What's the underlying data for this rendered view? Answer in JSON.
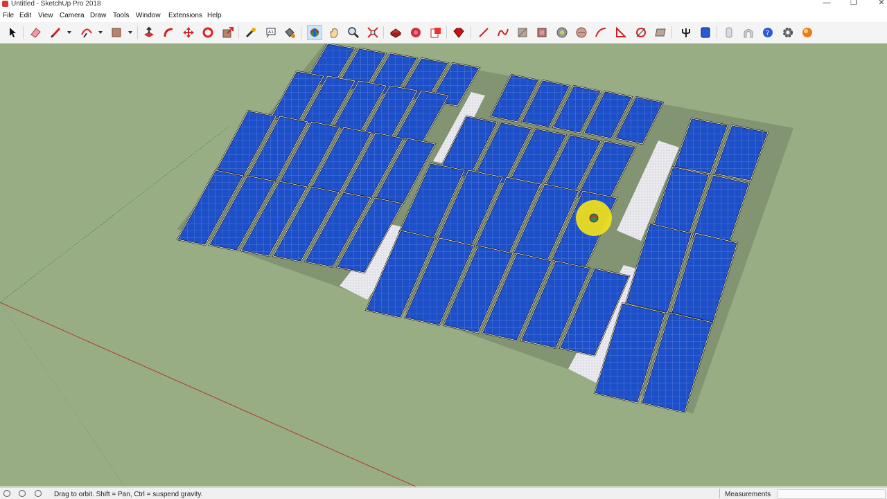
{
  "window": {
    "title": "Untitled - SketchUp Pro 2018",
    "minimize_glyph": "—",
    "restore_glyph": "❐",
    "close_glyph": "✕"
  },
  "menu": [
    "File",
    "Edit",
    "View",
    "Camera",
    "Draw",
    "Tools",
    "Window",
    "Extensions",
    "Help"
  ],
  "toolbar": {
    "active_tool": "orbit-icon",
    "tools": [
      "select-icon",
      "eraser-icon",
      "pencil-icon",
      "arc-icon",
      "rectangle-icon",
      "push-pull-icon",
      "follow-me-icon",
      "move-icon",
      "rotate-icon",
      "scale-icon",
      "tape-measure-icon",
      "text-icon",
      "paint-bucket-icon",
      "orbit-icon",
      "pan-icon",
      "zoom-icon",
      "zoom-extents-icon",
      "warehouse-icon",
      "extension-warehouse-icon",
      "layout-icon",
      "ruby-icon",
      "freehand-line-icon",
      "bezier-icon",
      "sandbox-grid-icon",
      "stamp-icon",
      "smoove-icon",
      "drape-icon",
      "add-detail-icon",
      "flip-edge-icon",
      "section-cut-icon",
      "draft-icon",
      "solar-north-icon",
      "solid-tools-icon",
      "tag-icon",
      "arch-icon",
      "help-icon",
      "settings-icon",
      "render-icon"
    ]
  },
  "colors": {
    "ground": "#99ad84",
    "panel": "#1d4fc8",
    "cursor_highlight": "#f2e21a"
  },
  "status": {
    "hint": "Drag to orbit. Shift = Pan, Ctrl = suspend gravity.",
    "measurements_label": "Measurements",
    "measurements_value": ""
  }
}
